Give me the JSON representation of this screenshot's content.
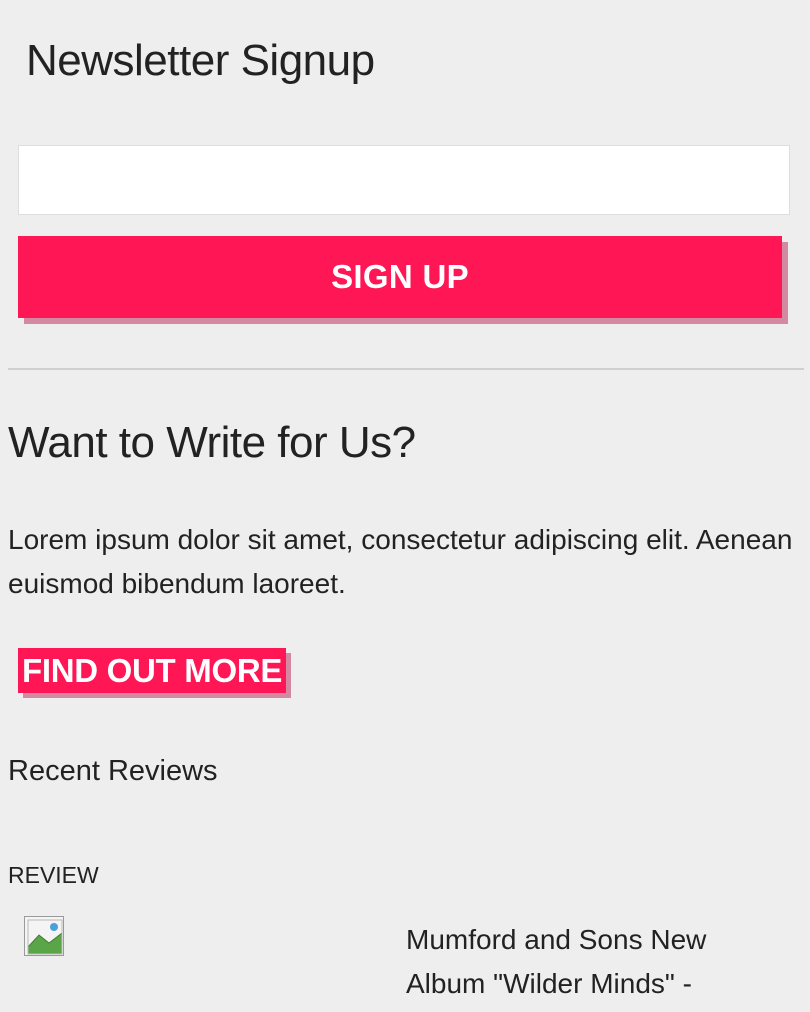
{
  "newsletter": {
    "title": "Newsletter Signup",
    "email_value": "",
    "button_label": "SIGN UP"
  },
  "write_for_us": {
    "title": "Want to Write for Us?",
    "body": "Lorem ipsum dolor sit amet, consectetur adipiscing elit. Aenean euismod bibendum laoreet.",
    "button_label": "FIND OUT MORE"
  },
  "recent_reviews": {
    "title": "Recent Reviews",
    "items": [
      {
        "tag": "REVIEW",
        "image_icon": "broken-image-icon",
        "headline": "Mumford and Sons New Album \"Wilder Minds\" -"
      }
    ]
  },
  "colors": {
    "accent": "#ff1654",
    "accent_shadow": "#d38aa0",
    "background": "#eeeeee",
    "text": "#222222"
  }
}
